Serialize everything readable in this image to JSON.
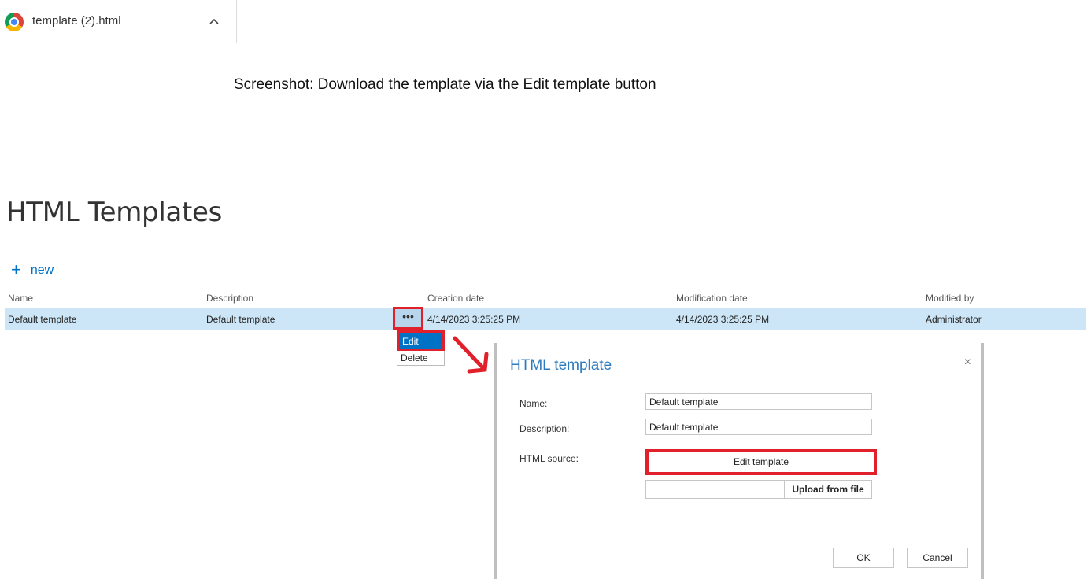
{
  "download_bar": {
    "filename": "template (2).html",
    "chevron": "^"
  },
  "caption": "Screenshot: Download the template via the Edit template button",
  "page": {
    "title": "HTML Templates",
    "new_label": "new",
    "new_icon": "+"
  },
  "table": {
    "headers": [
      "Name",
      "Description",
      "Creation date",
      "Modification date",
      "Modified by"
    ],
    "rows": [
      {
        "name": "Default template",
        "description": "Default template",
        "actions": "•••",
        "creation_date": "4/14/2023 3:25:25 PM",
        "modification_date": "4/14/2023 3:25:25 PM",
        "modified_by": "Administrator"
      }
    ]
  },
  "context_menu": {
    "items": [
      "Edit",
      "Delete"
    ]
  },
  "dialog": {
    "title": "HTML template",
    "close": "×",
    "name_label": "Name:",
    "name_value": "Default template",
    "description_label": "Description:",
    "description_value": "Default template",
    "source_label": "HTML source:",
    "edit_template_label": "Edit template",
    "upload_label": "Upload from file",
    "ok_label": "OK",
    "cancel_label": "Cancel"
  },
  "colors": {
    "accent": "#0072c6",
    "highlight": "#e0202a",
    "row_selected": "#cde6f7",
    "dialog_title": "#2f7bbf"
  }
}
